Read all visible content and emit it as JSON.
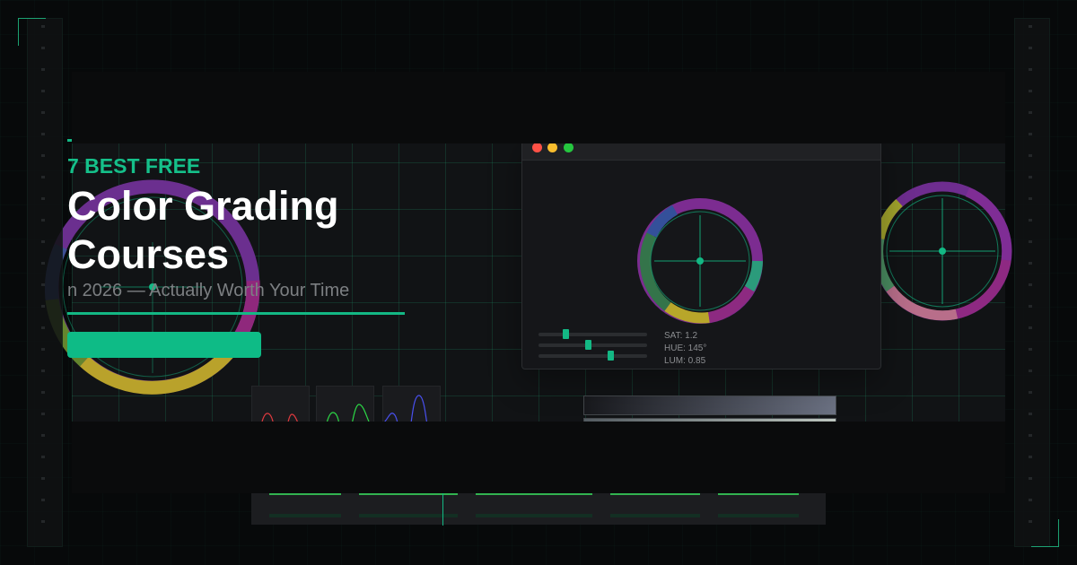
{
  "hero": {
    "eyebrow": "7 BEST FREE",
    "title_line_1": "Color Grading",
    "title_line_2": "Courses",
    "subtitle": "n 2026 — Actually Worth Your Time"
  },
  "grading_panel": {
    "readouts": {
      "sat": "SAT: 1.2",
      "hue": "HUE: 145°",
      "lum": "LUM: 0.85"
    }
  },
  "colors": {
    "accent": "#13b884",
    "background": "#111315",
    "grid": "#1f8f66",
    "close": "#ff5146",
    "minimize": "#f8bd2e",
    "maximize": "#25c63f",
    "timeline_red": "#d93f43",
    "timeline_green": "#32b350"
  },
  "icons": {
    "window_controls": [
      "close-dot-icon",
      "minimize-dot-icon",
      "maximize-dot-icon"
    ],
    "color_wheels": [
      "color-wheel-icon"
    ],
    "playhead": "playhead-marker-icon"
  }
}
